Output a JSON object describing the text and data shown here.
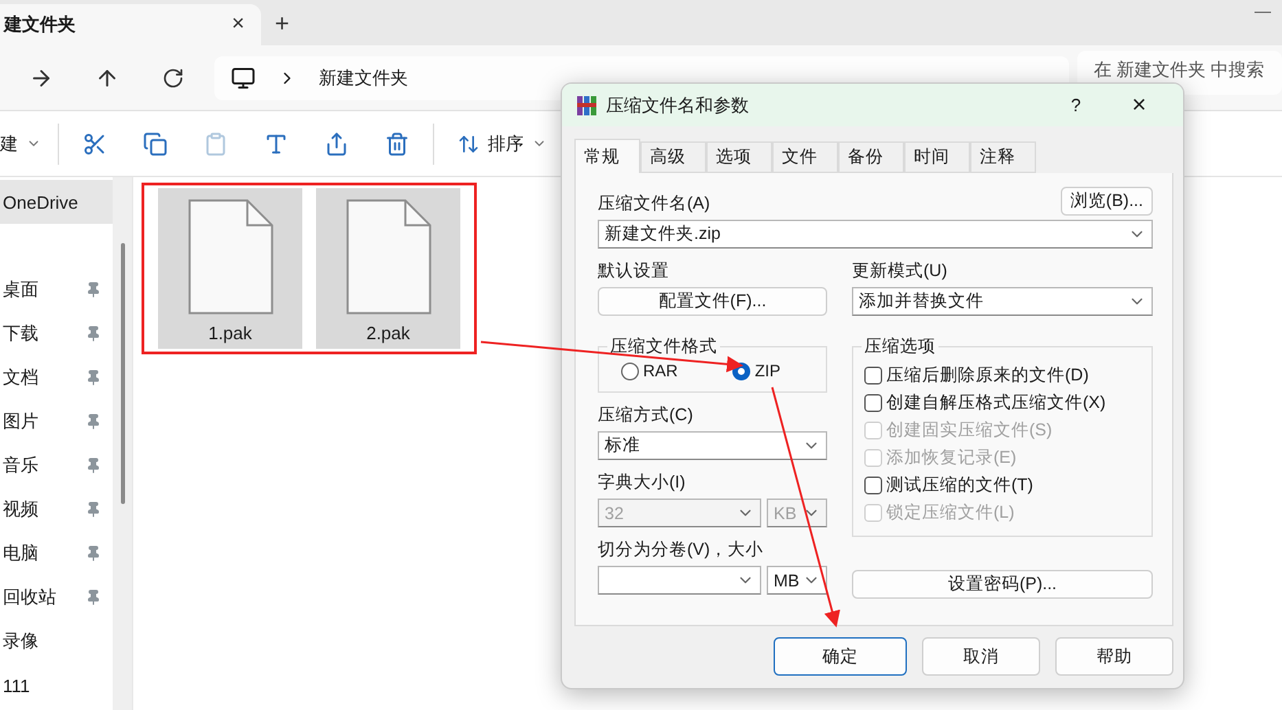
{
  "explorer": {
    "tab": {
      "title": "建文件夹",
      "close": "×"
    },
    "new_tab": "+",
    "minimize": "—",
    "breadcrumb": "新建文件夹",
    "search": {
      "placeholder": "在 新建文件夹 中搜索"
    },
    "toolbar": [
      {
        "kind": "new",
        "label": "建"
      },
      {
        "kind": "cut"
      },
      {
        "kind": "copy"
      },
      {
        "kind": "paste",
        "disabled": true
      },
      {
        "kind": "rename"
      },
      {
        "kind": "share"
      },
      {
        "kind": "delete"
      },
      {
        "kind": "sort",
        "label": "排序"
      }
    ],
    "sidebar": {
      "items": [
        {
          "label": "OneDrive",
          "selected": true,
          "pinned": false
        },
        {
          "label": "桌面",
          "selected": false,
          "pinned": true
        },
        {
          "label": "下载",
          "selected": false,
          "pinned": true
        },
        {
          "label": "文档",
          "selected": false,
          "pinned": true
        },
        {
          "label": "图片",
          "selected": false,
          "pinned": true
        },
        {
          "label": "音乐",
          "selected": false,
          "pinned": true
        },
        {
          "label": "视频",
          "selected": false,
          "pinned": true
        },
        {
          "label": "电脑",
          "selected": false,
          "pinned": true
        },
        {
          "label": "回收站",
          "selected": false,
          "pinned": true
        },
        {
          "label": "录像",
          "selected": false,
          "pinned": false
        },
        {
          "label": "111",
          "selected": false,
          "pinned": false
        }
      ]
    },
    "files": [
      {
        "name": "1.pak",
        "selected": true
      },
      {
        "name": "2.pak",
        "selected": true
      }
    ]
  },
  "dialog": {
    "title": "压缩文件名和参数",
    "help": "?",
    "close": "×",
    "tabs": [
      {
        "label": "常规",
        "selected": true
      },
      {
        "label": "高级",
        "selected": false
      },
      {
        "label": "选项",
        "selected": false
      },
      {
        "label": "文件",
        "selected": false
      },
      {
        "label": "备份",
        "selected": false
      },
      {
        "label": "时间",
        "selected": false
      },
      {
        "label": "注释",
        "selected": false
      }
    ],
    "archive_name": {
      "label": "压缩文件名(A)",
      "value": "新建文件夹.zip",
      "browse": "浏览(B)..."
    },
    "profile": {
      "label": "默认设置",
      "button": "配置文件(F)..."
    },
    "update_mode": {
      "label": "更新模式(U)",
      "value": "添加并替换文件"
    },
    "format": {
      "label": "压缩文件格式",
      "options": [
        {
          "label": "RAR",
          "selected": false
        },
        {
          "label": "ZIP",
          "selected": true
        }
      ]
    },
    "method": {
      "label": "压缩方式(C)",
      "value": "标准"
    },
    "dictionary": {
      "label": "字典大小(I)",
      "value": "32",
      "unit": "KB",
      "disabled": true
    },
    "split": {
      "label": "切分为分卷(V)，大小",
      "unit": "MB"
    },
    "options": {
      "label": "压缩选项",
      "items": [
        {
          "label": "压缩后删除原来的文件(D)",
          "checked": false,
          "disabled": false
        },
        {
          "label": "创建自解压格式压缩文件(X)",
          "checked": false,
          "disabled": false
        },
        {
          "label": "创建固实压缩文件(S)",
          "checked": false,
          "disabled": true
        },
        {
          "label": "添加恢复记录(E)",
          "checked": false,
          "disabled": true
        },
        {
          "label": "测试压缩的文件(T)",
          "checked": false,
          "disabled": false
        },
        {
          "label": "锁定压缩文件(L)",
          "checked": false,
          "disabled": true
        }
      ]
    },
    "password_button": "设置密码(P)...",
    "buttons": [
      {
        "label": "确定",
        "default": true
      },
      {
        "label": "取消",
        "default": false
      },
      {
        "label": "帮助",
        "default": false
      }
    ]
  }
}
